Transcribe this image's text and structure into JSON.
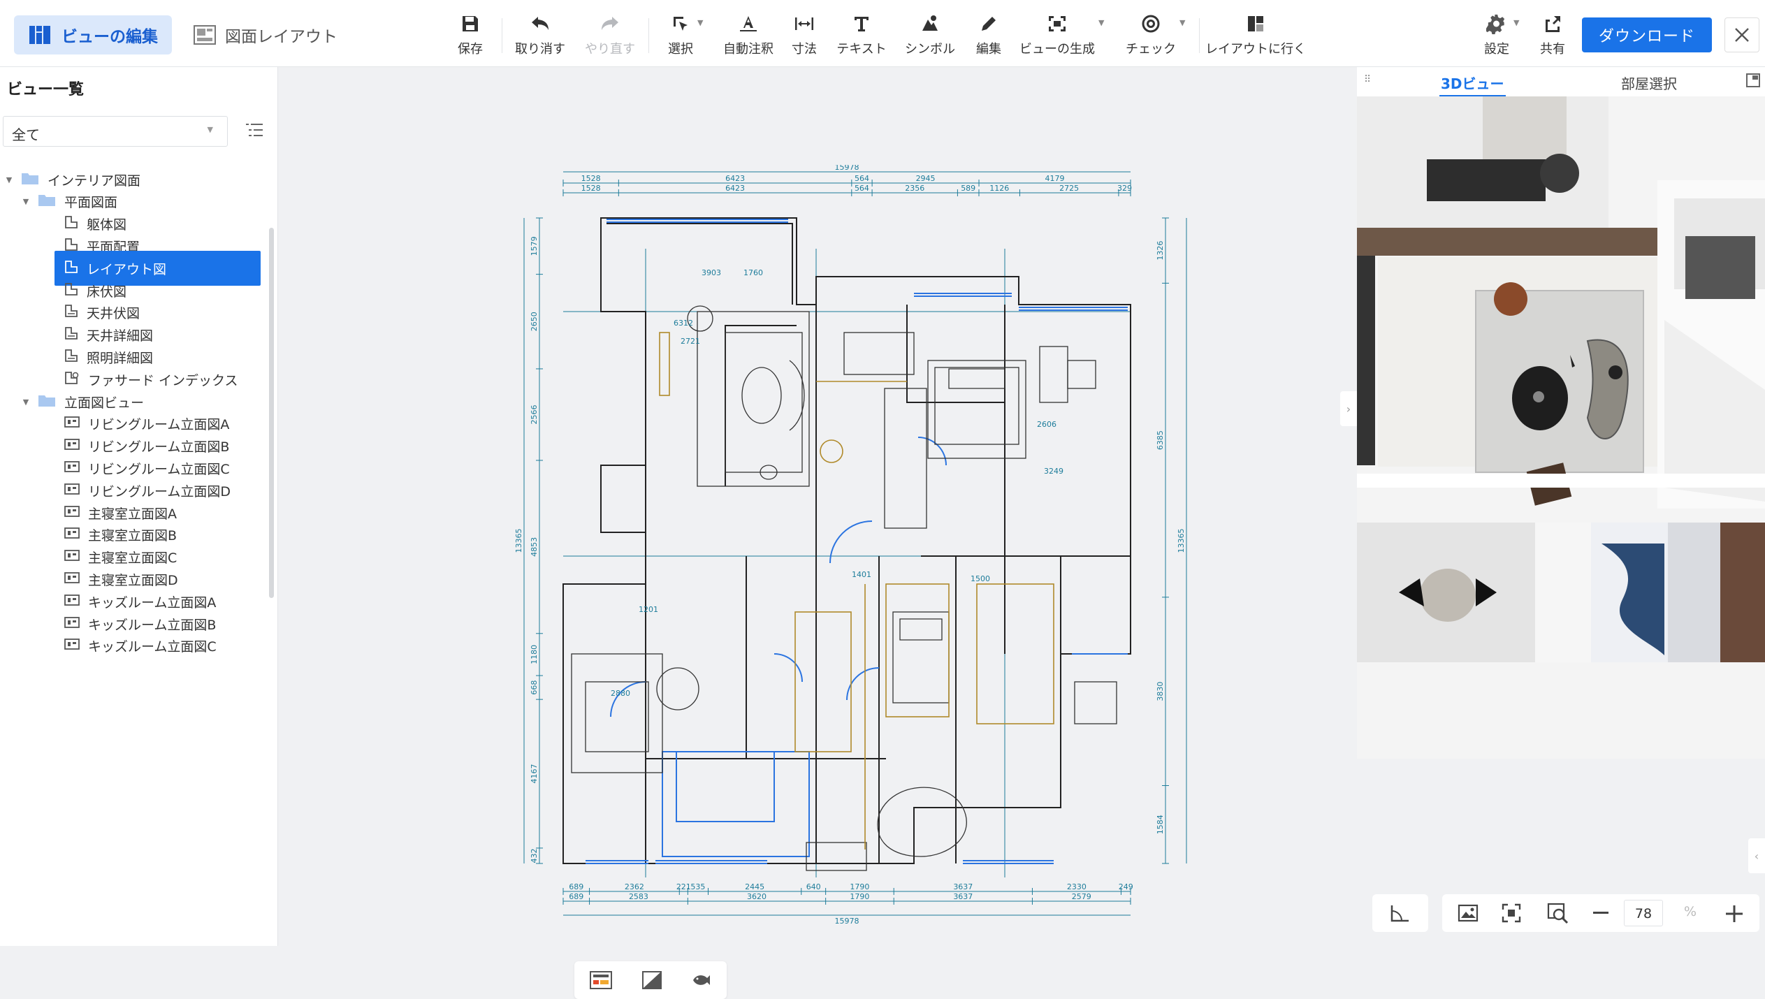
{
  "topbar": {
    "mode_tabs": [
      {
        "label": "ビューの編集",
        "active": true
      },
      {
        "label": "図面レイアウト",
        "active": false
      }
    ],
    "tools": {
      "save": "保存",
      "undo": "取り消す",
      "redo": "やり直す",
      "select": "選択",
      "auto_annotate": "自動注釈",
      "dimension": "寸法",
      "text": "テキスト",
      "symbol": "シンボル",
      "edit": "編集",
      "generate_view": "ビューの生成",
      "check": "チェック",
      "goto_layout": "レイアウトに行く",
      "settings": "設定",
      "share": "共有"
    },
    "download_label": "ダウンロード"
  },
  "sidebar": {
    "title": "ビュー一覧",
    "filter_value": "全て",
    "tree": [
      {
        "label": "インテリア図面",
        "kind": "folder",
        "level": 0
      },
      {
        "label": "平面図面",
        "kind": "folder",
        "level": 1
      },
      {
        "label": "躯体図",
        "kind": "plan",
        "level": 2
      },
      {
        "label": "平面配置",
        "kind": "plan",
        "level": 2
      },
      {
        "label": "レイアウト図",
        "kind": "plan",
        "level": 2,
        "selected": true
      },
      {
        "label": "床伏図",
        "kind": "plan",
        "level": 2
      },
      {
        "label": "天井伏図",
        "kind": "ceiling",
        "level": 2
      },
      {
        "label": "天井詳細図",
        "kind": "ceiling",
        "level": 2
      },
      {
        "label": "照明詳細図",
        "kind": "ceiling",
        "level": 2
      },
      {
        "label": "ファサード インデックス",
        "kind": "facade",
        "level": 2
      },
      {
        "label": "立面図ビュー",
        "kind": "folder",
        "level": 1
      },
      {
        "label": "リビングルーム立面図A",
        "kind": "elev",
        "level": 2
      },
      {
        "label": "リビングルーム立面図B",
        "kind": "elev",
        "level": 2
      },
      {
        "label": "リビングルーム立面図C",
        "kind": "elev",
        "level": 2
      },
      {
        "label": "リビングルーム立面図D",
        "kind": "elev",
        "level": 2
      },
      {
        "label": "主寝室立面図A",
        "kind": "elev",
        "level": 2
      },
      {
        "label": "主寝室立面図B",
        "kind": "elev",
        "level": 2
      },
      {
        "label": "主寝室立面図C",
        "kind": "elev",
        "level": 2
      },
      {
        "label": "主寝室立面図D",
        "kind": "elev",
        "level": 2
      },
      {
        "label": "キッズルーム立面図A",
        "kind": "elev",
        "level": 2
      },
      {
        "label": "キッズルーム立面図B",
        "kind": "elev",
        "level": 2
      },
      {
        "label": "キッズルーム立面図C",
        "kind": "elev",
        "level": 2
      }
    ]
  },
  "plan": {
    "top_total": "15978",
    "top_row1": [
      "1528",
      "6423",
      "564",
      "2945",
      "4179"
    ],
    "top_row2": [
      "1528",
      "6423",
      "564",
      "2356",
      "589",
      "1126",
      "2725",
      "329"
    ],
    "bottom_row1": [
      "689",
      "2362",
      "221",
      "535",
      "2445",
      "640",
      "1790",
      "3637",
      "2330",
      "249"
    ],
    "bottom_row2": [
      "689",
      "2583",
      "3620",
      "1790",
      "3637",
      "2579"
    ],
    "bottom_total": "15978",
    "left_total": "13365",
    "left_row": [
      "1579",
      "2650",
      "2566",
      "4853",
      "1180",
      "668",
      "4167",
      "432"
    ],
    "right_total": "13365",
    "right_row": [
      "1326",
      "6385",
      "3830",
      "1584"
    ],
    "room_labels": [
      "3903",
      "1760",
      "2721",
      "6312",
      "1401",
      "1500",
      "3249",
      "2606",
      "1201",
      "2880"
    ]
  },
  "right_panel": {
    "tabs": [
      "3Dビュー",
      "部屋選択"
    ],
    "active_tab": "3Dビュー"
  },
  "zoom": {
    "value": "78",
    "unit": "%"
  },
  "colors": {
    "accent": "#1a73e8",
    "dimension": "#1d7c9a",
    "wall": "#222222",
    "furniture_gold": "#b08a2a"
  }
}
